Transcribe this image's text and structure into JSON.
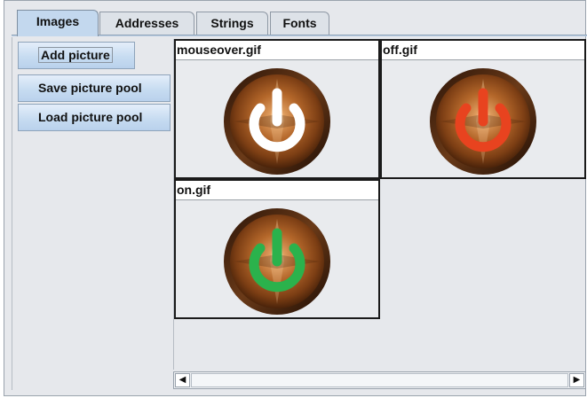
{
  "tabs": [
    {
      "label": "Images",
      "active": true
    },
    {
      "label": "Addresses",
      "active": false
    },
    {
      "label": "Strings",
      "active": false
    },
    {
      "label": "Fonts",
      "active": false
    }
  ],
  "buttons": {
    "add_picture": "Add picture",
    "save_pool": "Save picture pool",
    "load_pool": "Load picture pool"
  },
  "pictures": [
    {
      "filename": "mouseover.gif",
      "icon": "power-icon",
      "symbol_color": "#ffffff"
    },
    {
      "filename": "off.gif",
      "icon": "power-icon",
      "symbol_color": "#e8431f"
    },
    {
      "filename": "on.gif",
      "icon": "power-icon",
      "symbol_color": "#2bb24c"
    }
  ],
  "scrollbar": {
    "left_arrow": "◀",
    "right_arrow": "▶"
  },
  "colors": {
    "button_rim": "#6a3a18",
    "button_face": "#b4672a"
  }
}
